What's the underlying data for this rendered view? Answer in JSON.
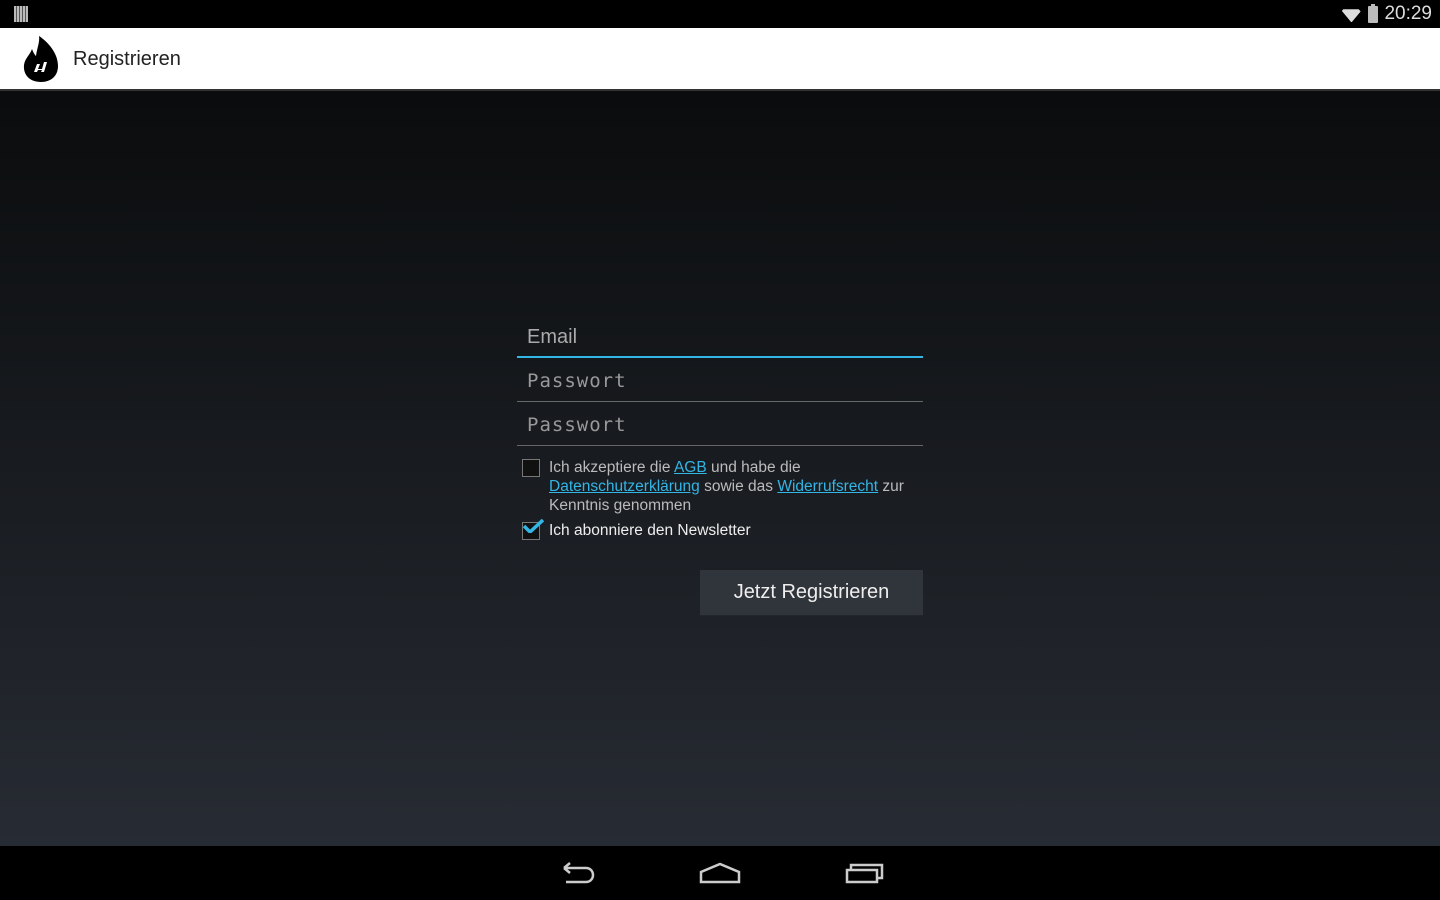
{
  "status": {
    "time": "20:29"
  },
  "actionbar": {
    "title": "Registrieren"
  },
  "form": {
    "email_placeholder": "Email",
    "password_placeholder": "Passwort",
    "password_confirm_placeholder": "Passwort",
    "terms": {
      "checked": false,
      "t1": "Ich akzeptiere die ",
      "agb": "AGB",
      "t2": " und habe die ",
      "privacy": "Datenschutzerklärung",
      "t3": " sowie das ",
      "withdrawal": "Widerrufsrecht",
      "t4": " zur Kenntnis genommen"
    },
    "newsletter": {
      "checked": true,
      "label": "Ich abonniere den Newsletter"
    },
    "submit_label": "Jetzt Registrieren"
  },
  "colors": {
    "accent": "#33b5e5"
  }
}
